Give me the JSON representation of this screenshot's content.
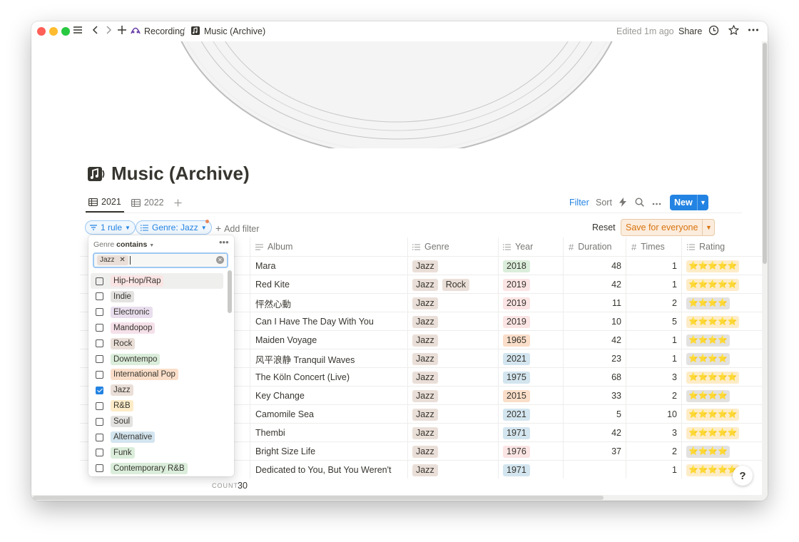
{
  "titlebar": {
    "breadcrumb_parent": "Recording",
    "breadcrumb_sep": "/",
    "breadcrumb_current": "Music (Archive)",
    "edited": "Edited 1m ago",
    "share": "Share"
  },
  "page": {
    "title": "Music (Archive)"
  },
  "tabs": [
    {
      "label": "2021"
    },
    {
      "label": "2022"
    }
  ],
  "toolbar": {
    "filter": "Filter",
    "sort": "Sort",
    "new": "New"
  },
  "filterbar": {
    "rule": "1 rule",
    "genre_filter": "Genre: Jazz",
    "add_filter": "Add filter",
    "reset": "Reset",
    "save": "Save for everyone"
  },
  "table": {
    "columns": {
      "album": "Album",
      "genre": "Genre",
      "year": "Year",
      "duration": "Duration",
      "times": "Times",
      "rating": "Rating"
    },
    "rows": [
      {
        "album": "Mara",
        "genres": [
          "Jazz"
        ],
        "year": "2018",
        "year_color": "#dbeddb",
        "duration": "48",
        "times": "1",
        "rating": "⭐⭐⭐⭐⭐",
        "stars_color": "#fdecc8"
      },
      {
        "album": "Red Kite",
        "genres": [
          "Jazz",
          "Rock"
        ],
        "year": "2019",
        "year_color": "#fbe4e4",
        "duration": "42",
        "times": "1",
        "rating": "⭐⭐⭐⭐⭐",
        "stars_color": "#fdecc8"
      },
      {
        "album": "怦然心動",
        "genres": [
          "Jazz"
        ],
        "year": "2019",
        "year_color": "#fbe4e4",
        "duration": "11",
        "times": "2",
        "rating": "⭐⭐⭐⭐",
        "stars_color": "#e3e2e0"
      },
      {
        "album": "Can I Have The Day With You",
        "genres": [
          "Jazz"
        ],
        "year": "2019",
        "year_color": "#fbe4e4",
        "duration": "10",
        "times": "5",
        "rating": "⭐⭐⭐⭐⭐",
        "stars_color": "#fdecc8"
      },
      {
        "album": "Maiden Voyage",
        "genres": [
          "Jazz"
        ],
        "year": "1965",
        "year_color": "#fadec9",
        "duration": "42",
        "times": "1",
        "rating": "⭐⭐⭐⭐",
        "stars_color": "#e3e2e0"
      },
      {
        "album": "风平浪静 Tranquil Waves",
        "genres": [
          "Jazz"
        ],
        "year": "2021",
        "year_color": "#d3e5ef",
        "duration": "23",
        "times": "1",
        "rating": "⭐⭐⭐⭐",
        "stars_color": "#e3e2e0"
      },
      {
        "album": "The Köln Concert (Live)",
        "genres": [
          "Jazz"
        ],
        "year": "1975",
        "year_color": "#d3e5ef",
        "duration": "68",
        "times": "3",
        "rating": "⭐⭐⭐⭐⭐",
        "stars_color": "#fdecc8"
      },
      {
        "album": "Key Change",
        "genres": [
          "Jazz"
        ],
        "year": "2015",
        "year_color": "#fadec9",
        "duration": "33",
        "times": "2",
        "rating": "⭐⭐⭐⭐",
        "stars_color": "#e3e2e0"
      },
      {
        "album": "Camomile Sea",
        "genres": [
          "Jazz"
        ],
        "year": "2021",
        "year_color": "#d3e5ef",
        "duration": "5",
        "times": "10",
        "rating": "⭐⭐⭐⭐⭐",
        "stars_color": "#fdecc8"
      },
      {
        "album": "Thembi",
        "genres": [
          "Jazz"
        ],
        "year": "1971",
        "year_color": "#d3e5ef",
        "duration": "42",
        "times": "3",
        "rating": "⭐⭐⭐⭐⭐",
        "stars_color": "#fdecc8"
      },
      {
        "album": "Bright Size Life",
        "genres": [
          "Jazz"
        ],
        "year": "1976",
        "year_color": "#fbe4e4",
        "duration": "37",
        "times": "2",
        "rating": "⭐⭐⭐⭐",
        "stars_color": "#e3e2e0"
      },
      {
        "album": "Dedicated to You, But You Weren't",
        "genres": [
          "Jazz"
        ],
        "year": "1971",
        "year_color": "#d3e5ef",
        "duration": "",
        "times": "1",
        "rating": "⭐⭐⭐⭐⭐",
        "stars_color": "#fdecc8"
      }
    ],
    "count_label": "COUNT",
    "count_value": "30"
  },
  "tag_colors": {
    "Jazz": "#eadfd8",
    "Rock": "#eadfd8"
  },
  "dropdown": {
    "property": "Genre",
    "operator": "contains",
    "selected_chip": "Jazz",
    "options": [
      {
        "label": "Hip-Hop/Rap",
        "color": "#fbe4e4",
        "checked": false
      },
      {
        "label": "Indie",
        "color": "#e3e2e0",
        "checked": false
      },
      {
        "label": "Electronic",
        "color": "#e8deee",
        "checked": false
      },
      {
        "label": "Mandopop",
        "color": "#f5e0e9",
        "checked": false
      },
      {
        "label": "Rock",
        "color": "#eadfd8",
        "checked": false
      },
      {
        "label": "Downtempo",
        "color": "#dbeddb",
        "checked": false
      },
      {
        "label": "International Pop",
        "color": "#fadec9",
        "checked": false
      },
      {
        "label": "Jazz",
        "color": "#eadfd8",
        "checked": true
      },
      {
        "label": "R&B",
        "color": "#fdecc8",
        "checked": false
      },
      {
        "label": "Soul",
        "color": "#e3e2e0",
        "checked": false
      },
      {
        "label": "Alternative",
        "color": "#d3e5ef",
        "checked": false
      },
      {
        "label": "Funk",
        "color": "#dbeddb",
        "checked": false
      },
      {
        "label": "Contemporary R&B",
        "color": "#dbeddb",
        "checked": false
      }
    ]
  },
  "help": "?"
}
